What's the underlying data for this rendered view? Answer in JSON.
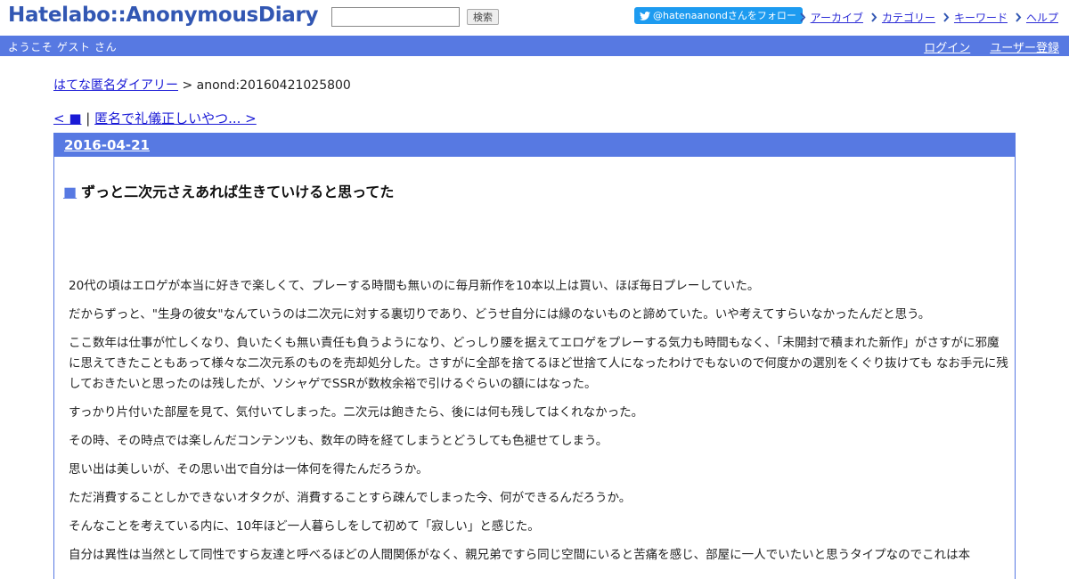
{
  "header": {
    "logo": "Hatelabo::AnonymousDiary",
    "search_placeholder": "",
    "search_button": "検索",
    "follow_button": "@hatenaanondさんをフォロー",
    "nav": [
      {
        "label": "アーカイブ"
      },
      {
        "label": "カテゴリー"
      },
      {
        "label": "キーワード"
      },
      {
        "label": "ヘルプ"
      }
    ]
  },
  "welcome_bar": {
    "text": "ようこそ ゲスト さん",
    "login": "ログイン",
    "register": "ユーザー登録"
  },
  "breadcrumb": {
    "home": "はてな匿名ダイアリー",
    "separator": " > ",
    "current": "anond:20160421025800"
  },
  "pager": {
    "prev": "< ■",
    "sep": " | ",
    "next": "匿名で礼儀正しいやつ... >"
  },
  "day": {
    "date": "2016-04-21",
    "entry_marker": "■",
    "title": "ずっと二次元さえあれば生きていけると思ってた",
    "paragraphs": [
      "20代の頃はエロゲが本当に好きで楽しくて、プレーする時間も無いのに毎月新作を10本以上は買い、ほぼ毎日プレーしていた。",
      "だからずっと、\"生身の彼女\"なんていうのは二次元に対する裏切りであり、どうせ自分には縁のないものと諦めていた。いや考えてすらいなかったんだと思う。",
      "ここ数年は仕事が忙しくなり、負いたくも無い責任も負うようになり、どっしり腰を据えてエロゲをプレーする気力も時間もなく、「未開封で積まれた新作」がさすがに邪魔に思えてきたこともあって様々な二次元系のものを売却処分した。さすがに全部を捨てるほど世捨て人になったわけでもないので何度かの選別をくぐり抜けても なお手元に残しておきたいと思ったのは残したが、ソシャゲでSSRが数枚余裕で引けるぐらいの額にはなった。",
      "すっかり片付いた部屋を見て、気付いてしまった。二次元は飽きたら、後には何も残してはくれなかった。",
      "その時、その時点では楽しんだコンテンツも、数年の時を経てしまうとどうしても色褪せてしまう。",
      "思い出は美しいが、その思い出で自分は一体何を得たんだろうか。",
      "ただ消費することしかできないオタクが、消費することすら疎んでしまった今、何ができるんだろうか。",
      "そんなことを考えている内に、10年ほど一人暮らしをして初めて「寂しい」と感じた。",
      "自分は異性は当然として同性ですら友達と呼べるほどの人間関係がなく、親兄弟ですら同じ空間にいると苦痛を感じ、部屋に一人でいたいと思うタイプなのでこれは本"
    ]
  },
  "colors": {
    "accent": "#5779e2",
    "logo": "#3257b3",
    "link": "#1a1ad6",
    "twitter": "#1d9bf0"
  }
}
